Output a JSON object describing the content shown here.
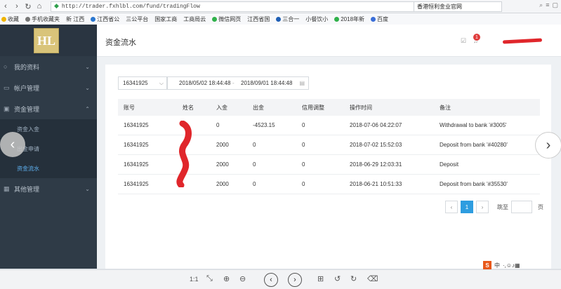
{
  "browser": {
    "url": "http://trader.fxhlbl.com/fund/tradingFlow",
    "search_text": "香港恒利金业官网",
    "bookmarks": [
      "收藏",
      "手机收藏夹",
      "新 江西",
      "江西省公",
      "三公平台",
      "国家工商",
      "工商局云",
      "微信网页",
      "江西省国",
      "三合一",
      "小餐饮小",
      "2018年新",
      "百度"
    ]
  },
  "sidebar": {
    "items": [
      {
        "label": "我的资料"
      },
      {
        "label": "帐户管理"
      },
      {
        "label": "资金管理"
      },
      {
        "label": "其他管理"
      }
    ],
    "sub_items": [
      {
        "label": "资金入金"
      },
      {
        "label": "出金申请"
      },
      {
        "label": "资金流水"
      }
    ]
  },
  "header": {
    "title": "资金流水",
    "notification_count": "1"
  },
  "filters": {
    "account": "16341925",
    "start_date": "2018/05/02 18:44:48",
    "end_date": "2018/09/01 18:44:48"
  },
  "table": {
    "headers": [
      "账号",
      "姓名",
      "入金",
      "出金",
      "信用调整",
      "操作时间",
      "备注"
    ],
    "rows": [
      {
        "account": "16341925",
        "name": "",
        "deposit": "0",
        "withdraw": "-4523.15",
        "credit": "0",
        "time": "2018-07-06 04:22:07",
        "note": "Withdrawal to bank '#3005'"
      },
      {
        "account": "16341925",
        "name": "",
        "deposit": "2000",
        "withdraw": "0",
        "credit": "0",
        "time": "2018-07-02 15:52:03",
        "note": "Deposit from bank '#40280'"
      },
      {
        "account": "16341925",
        "name": "",
        "deposit": "2000",
        "withdraw": "0",
        "credit": "0",
        "time": "2018-06-29 12:03:31",
        "note": "Deposit"
      },
      {
        "account": "16341925",
        "name": "",
        "deposit": "2000",
        "withdraw": "0",
        "credit": "0",
        "time": "2018-06-21 10:51:33",
        "note": "Deposit from bank '#35530'"
      }
    ]
  },
  "pagination": {
    "current_page": "1",
    "goto_label": "跳至",
    "page_suffix": "页"
  },
  "viewer": {
    "zoom_label": "1:1"
  },
  "colors": {
    "sidebar": "#2f3b47",
    "accent": "#2e9de0",
    "badge": "#e03c3c"
  }
}
